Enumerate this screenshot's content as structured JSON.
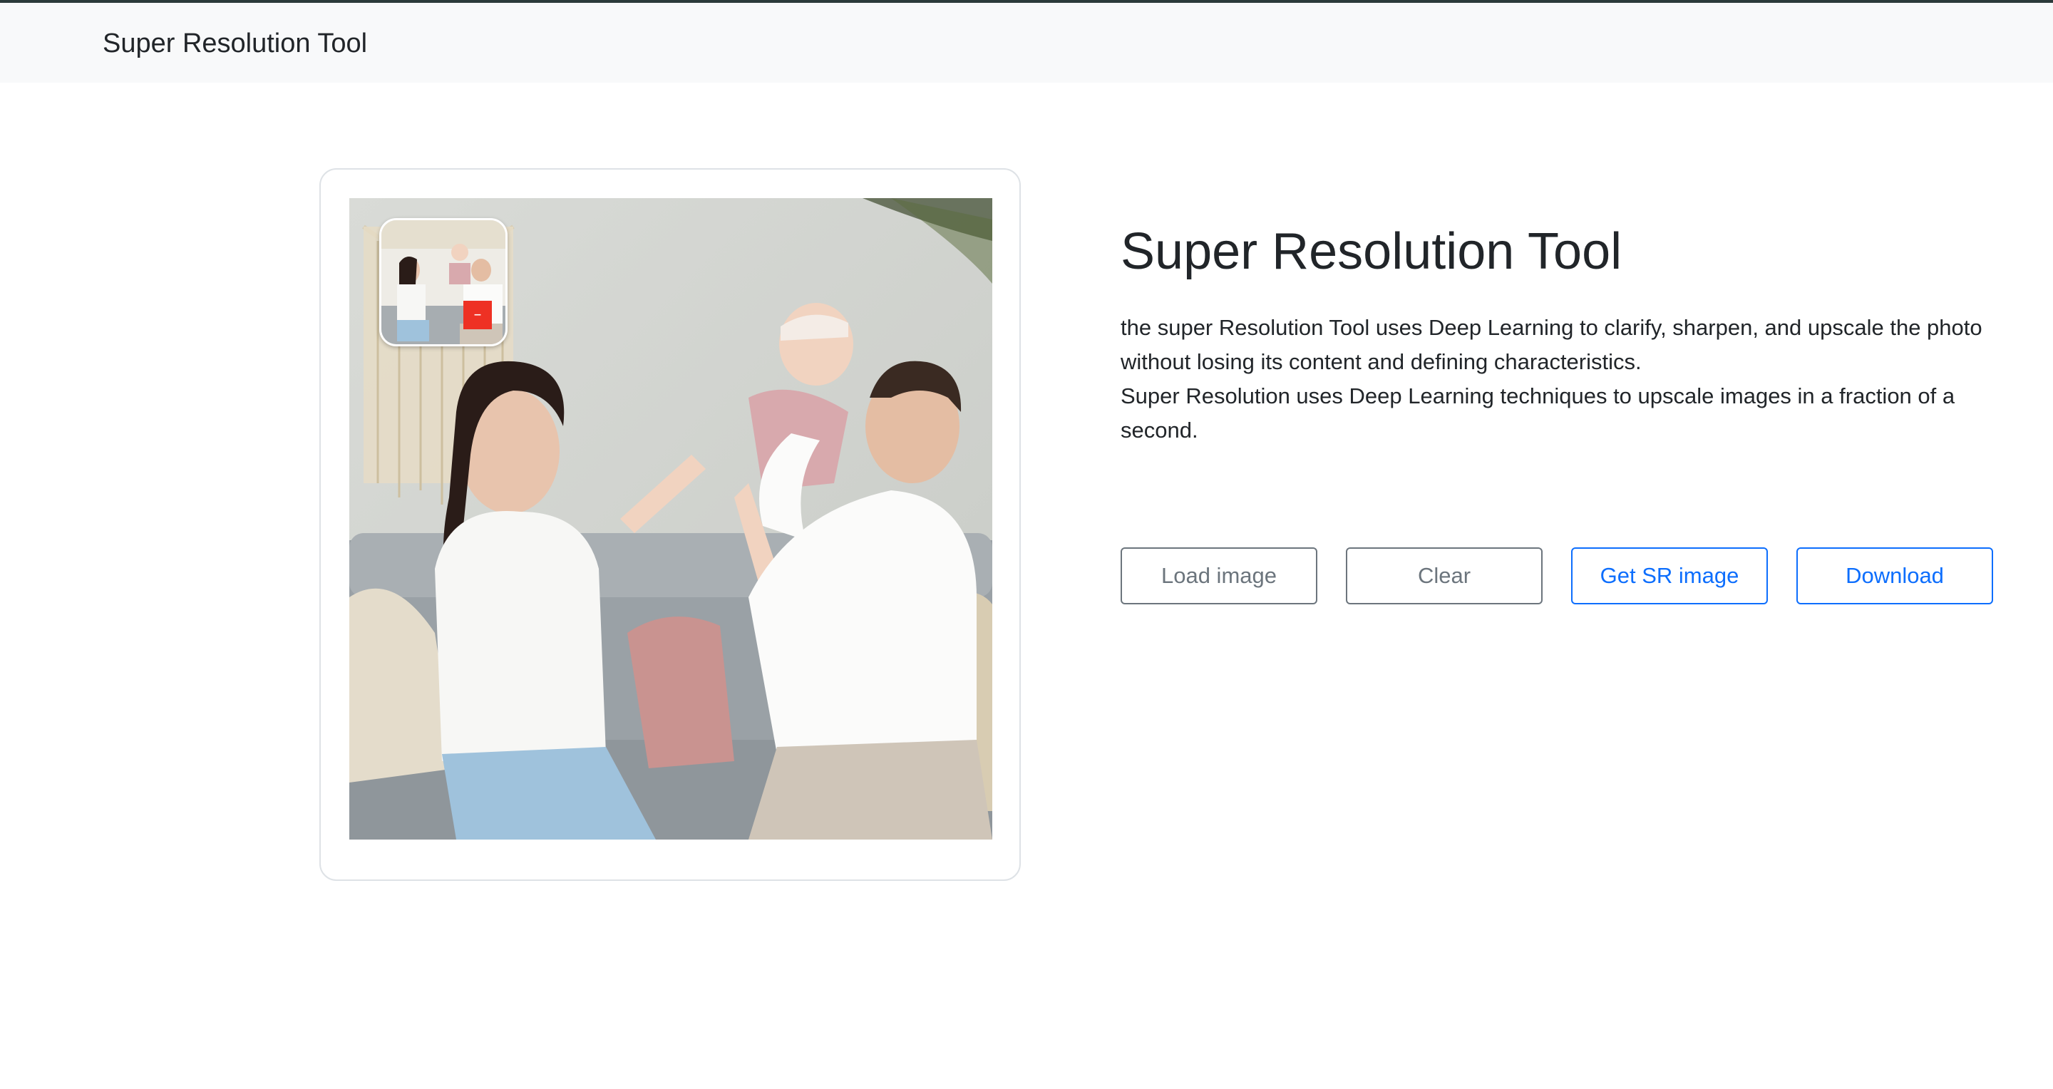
{
  "navbar": {
    "brand": "Super Resolution Tool"
  },
  "main": {
    "title": "Super Resolution Tool",
    "description_lines": [
      "the super Resolution Tool uses Deep Learning to clarify, sharpen, and upscale the photo without losing its content and defining characteristics.",
      "Super Resolution uses Deep Learning techniques to upscale images in a fraction of a second."
    ]
  },
  "preview": {
    "remove_button_label": "–"
  },
  "actions": {
    "load": "Load image",
    "clear": "Clear",
    "get_sr": "Get SR image",
    "download": "Download"
  },
  "colors": {
    "primary": "#0d6efd",
    "secondary": "#6c757d",
    "navbar_bg": "#f8f9fa",
    "remove_button": "#ee3124"
  }
}
